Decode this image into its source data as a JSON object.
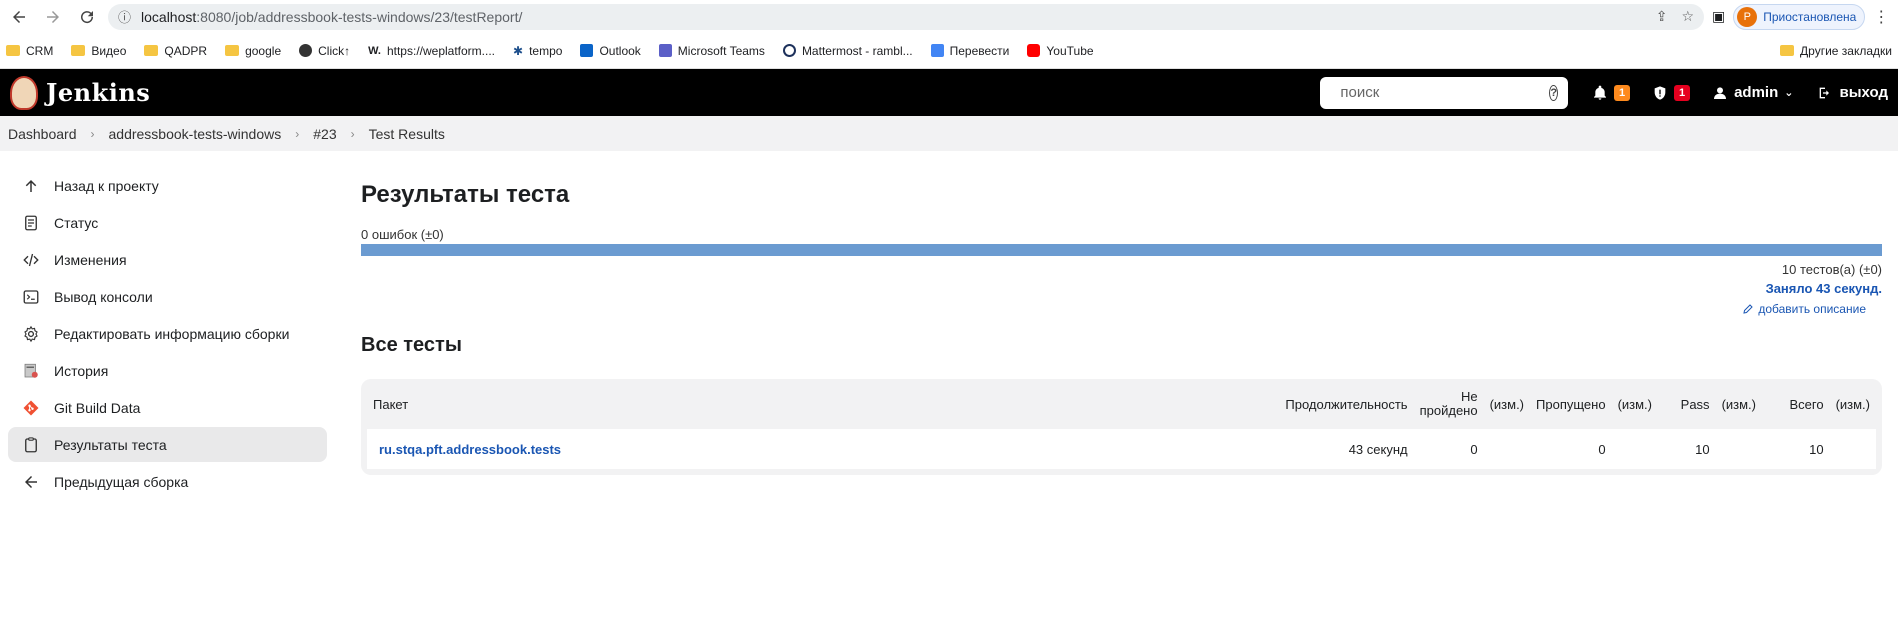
{
  "browser": {
    "url_host": "localhost",
    "url_path": ":8080/job/addressbook-tests-windows/23/testReport/",
    "profile_initial": "P",
    "profile_label": "Приостановлена",
    "bookmarks": [
      {
        "label": "CRM",
        "icon": "folder-icon"
      },
      {
        "label": "Видео",
        "icon": "folder-icon"
      },
      {
        "label": "QADPR",
        "icon": "folder-icon"
      },
      {
        "label": "google",
        "icon": "folder-icon"
      },
      {
        "label": "Click↑",
        "icon": "click-icon"
      },
      {
        "label": "https://weplatform....",
        "icon": "weplatform-icon"
      },
      {
        "label": "tempo",
        "icon": "tempo-icon"
      },
      {
        "label": "Outlook",
        "icon": "outlook-icon"
      },
      {
        "label": "Microsoft Teams",
        "icon": "teams-icon"
      },
      {
        "label": "Mattermost - rambl...",
        "icon": "mattermost-icon"
      },
      {
        "label": "Перевести",
        "icon": "translate-icon"
      },
      {
        "label": "YouTube",
        "icon": "youtube-icon"
      }
    ],
    "other_bookmarks": "Другие закладки"
  },
  "header": {
    "brand": "Jenkins",
    "search_placeholder": "поиск",
    "notifications_count": "1",
    "security_count": "1",
    "user": "admin",
    "logout": "выход"
  },
  "breadcrumb": [
    "Dashboard",
    "addressbook-tests-windows",
    "#23",
    "Test Results"
  ],
  "sidebar": {
    "items": [
      {
        "label": "Назад к проекту",
        "icon": "arrow-up-icon"
      },
      {
        "label": "Статус",
        "icon": "document-icon"
      },
      {
        "label": "Изменения",
        "icon": "code-icon"
      },
      {
        "label": "Вывод консоли",
        "icon": "terminal-icon"
      },
      {
        "label": "Редактировать информацию сборки",
        "icon": "gear-icon"
      },
      {
        "label": "История",
        "icon": "history-icon"
      },
      {
        "label": "Git Build Data",
        "icon": "git-icon"
      },
      {
        "label": "Результаты теста",
        "icon": "clipboard-icon"
      },
      {
        "label": "Предыдущая сборка",
        "icon": "arrow-left-icon"
      }
    ]
  },
  "main": {
    "title": "Результаты теста",
    "failures": "0 ошибок (±0)",
    "pass_fraction": 1.0,
    "tests_count": "10 тестов(а) (±0)",
    "duration": "Заняло 43 секунд.",
    "add_description": "добавить описание",
    "all_tests_title": "Все тесты",
    "table": {
      "headers": {
        "package": "Пакет",
        "duration": "Продолжительность",
        "failed": "Не пройдено",
        "failed_diff": "(изм.)",
        "skipped": "Пропущено",
        "skipped_diff": "(изм.)",
        "pass": "Pass",
        "pass_diff": "(изм.)",
        "total": "Всего",
        "total_diff": "(изм.)"
      },
      "rows": [
        {
          "package": "ru.stqa.pft.addressbook.tests",
          "duration": "43 секунд",
          "failed": "0",
          "failed_diff": "",
          "skipped": "0",
          "skipped_diff": "",
          "pass": "10",
          "pass_diff": "",
          "total": "10",
          "total_diff": ""
        }
      ]
    }
  },
  "colors": {
    "accent_link": "#1a56b3",
    "progress_pass": "#6b9bd1",
    "header_bg": "#000000",
    "badge_orange": "#fe8a1d",
    "badge_red": "#e6001f"
  }
}
